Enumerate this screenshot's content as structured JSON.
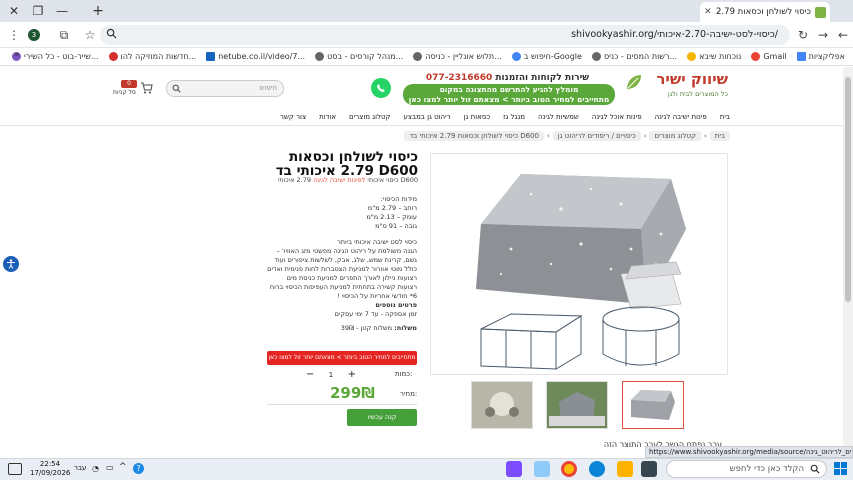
{
  "browser": {
    "tab_title": "כיסוי לשולחן וכסאות 2.79 איכותי",
    "url": "shivookyashir.org/כיסוי-לסט-ישיבה-2.70-איכותי/",
    "bookmarks": [
      "אפליקציות",
      "Gmail",
      "נוכחות שיבא",
      "רשות המסים - כניס...",
      "חיפוש ב-Google",
      "תלוש אונליין - כניסה...",
      "מנהל קורסים - בסט...",
      "netube.co.il/video/7...",
      "חדשות המוזיקה להו...",
      "שייר-בוט - כל השירי..."
    ]
  },
  "header": {
    "logo_name": "שיווק ישיר",
    "logo_tagline": "כל המוצרים לבית ולגן",
    "phone_label": "שירות לקוחות והזמנות",
    "phone": "077-2316660",
    "banner_line1": "מומלץ להגיע להתרשם מהתצוגה במקום",
    "banner_line2": "מתחייבים למחיר הטוב ביותר > מצאתם זול יותר למצו כאן",
    "search_placeholder": "חיפוש",
    "cart_count": "0",
    "cart_label": "סל קניות"
  },
  "nav": [
    "בית",
    "פינות ישיבה לגינה",
    "פינות אוכל לגינה",
    "שמשיות לגינה",
    "מנגל גז",
    "כסאות גן",
    "ריהוט גן במבצע",
    "קטלוג מוצרים",
    "אודות",
    "צור קשר"
  ],
  "breadcrumbs": [
    "בית",
    "קטלוג מוצרים",
    "כיסויים / ריפודים לריהוט גן",
    "כיסוי לשולחן וכסאות 2.79 איכותי בד D600"
  ],
  "product": {
    "title": "כיסוי לשולחן וכסאות 2.79 איכותי בד D600",
    "category_prefix": "כיסוי איכותי",
    "category_link": "לפינות ישיבה לגינה",
    "category_suffix": "2.79 איכותי D600",
    "dims_title": "מידות הכיסוי:",
    "dims": [
      "רוחב – 2.79 מ\"מ",
      "עומק – 2.13 מ\"מ",
      "גובה – 91 ס\"מ"
    ],
    "desc_lines": [
      "כיסוי לסט ישיבה איכותי ביותר",
      "הגנה משולמת על ריהוט הגינה מפשטי מזג האוויר –",
      "גשם, קרינת שמש, שלג, אבק, לשלשות ציפורים ועוד",
      "כולל מוטי אוורור למניעת הצטברות לחות פנימית ואדים",
      "רצועות ניילון לאורך התפרים למניעת כניסת מים",
      "רצועות קשירה בתחתית למניעת העפיפות הכיסוי ברוח",
      "6* חודשי אחריות על הכיסוי !"
    ],
    "shipping_title": "פרטים נוספים",
    "shipping": "זמן אספקה - עד 7 ימי עסקים",
    "delivery_label": "משלוח:",
    "delivery_value": "משלוח קטן - 39₪",
    "price_match_button": "מתחייבים למחיר הטוב ביותר > מצאתם יותר זול למצו כאן",
    "qty_label": "כמות:",
    "qty_value": "1",
    "price_label": "מחיר:",
    "price": "299₪",
    "buy_button": "קנה עכשיו",
    "desc_heading": "ערב נפתח הגשר לערב התוצר הזה"
  },
  "status_url": "https://www.shivookyashir.org/media/source/כיסויים_לריהוט_גינה.jpg",
  "taskbar": {
    "search_placeholder": "הקלד כאן כדי לחפש",
    "time": "22:54",
    "date": "17/09/2026",
    "lang": "עבר"
  },
  "colors": {
    "brand_red": "#c0392b",
    "brand_green": "#5aa83a",
    "price_green": "#5aa83a",
    "cta_red": "#e52521"
  }
}
